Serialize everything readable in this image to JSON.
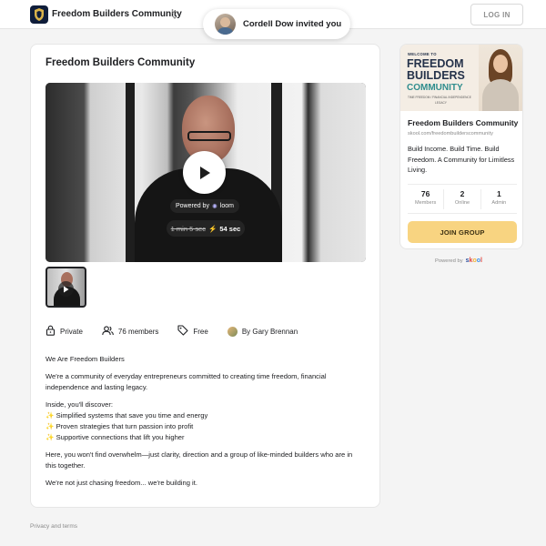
{
  "header": {
    "group_name": "Freedom Builders Community",
    "login_label": "LOG IN"
  },
  "invite": {
    "text": "Cordell Dow invited you"
  },
  "main": {
    "title": "Freedom Builders Community",
    "video": {
      "powered_by": "Powered by",
      "loom": "loom",
      "old_duration": "1 min 5 sec",
      "new_duration": "54 sec"
    },
    "meta": {
      "privacy": "Private",
      "members": "76 members",
      "price": "Free",
      "author": "By Gary Brennan"
    },
    "description": [
      "We Are Freedom Builders",
      "We're a community of everyday entrepreneurs committed to creating time freedom, financial independence and lasting legacy.",
      "Inside, you'll discover:",
      "✨ Simplified systems that save you time and energy",
      "✨ Proven strategies that turn passion into profit",
      "✨ Supportive connections that lift you higher",
      "Here, you won't find overwhelm—just clarity, direction and a group of like-minded builders who are in this together.",
      "We're not just chasing freedom... we're building it."
    ]
  },
  "sidebar": {
    "banner": {
      "welcome": "WELCOME TO",
      "line1": "FREEDOM",
      "line2": "BUILDERS",
      "line3": "COMMUNITY",
      "tagline": "TIME FREEDOM / FINANCIAL INDEPENDENCE",
      "tagline2": "LEGACY"
    },
    "title": "Freedom Builders Community",
    "url": "skool.com/freedombuilderscommunity",
    "description": "Build Income. Build Time. Build Freedom. A Community for Limitless Living.",
    "stats": [
      {
        "value": "76",
        "label": "Members"
      },
      {
        "value": "2",
        "label": "Online"
      },
      {
        "value": "1",
        "label": "Admin"
      }
    ],
    "join_label": "JOIN GROUP",
    "powered_by": "Powered by",
    "brand": [
      "s",
      "k",
      "o",
      "o",
      "l"
    ]
  },
  "footer": {
    "privacy_terms": "Privacy and terms"
  },
  "colors": {
    "join_button": "#f8d481",
    "logo_bg": "#0f1d3a"
  }
}
